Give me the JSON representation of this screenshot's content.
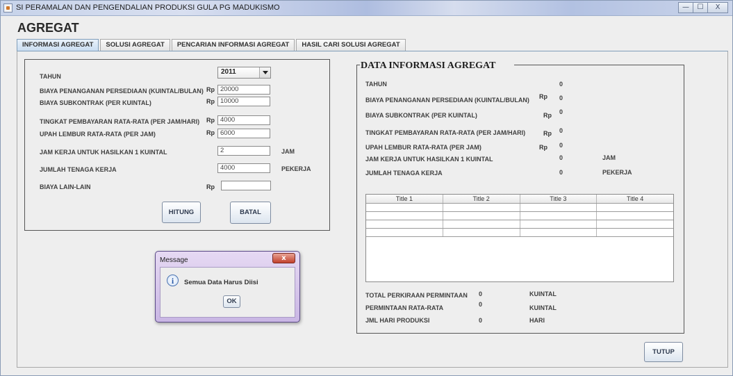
{
  "window": {
    "title": "SI PERAMALAN DAN PENGENDALIAN PRODUKSI GULA PG MADUKISMO"
  },
  "controls": {
    "minimize": "—",
    "maximize": "☐",
    "close": "X"
  },
  "page": {
    "heading": "AGREGAT"
  },
  "tabs": [
    {
      "label": "INFORMASI AGREGAT",
      "active": true
    },
    {
      "label": "SOLUSI AGREGAT"
    },
    {
      "label": "PENCARIAN INFORMASI AGREGAT"
    },
    {
      "label": "HASIL CARI SOLUSI AGREGAT"
    }
  ],
  "form": {
    "rp": "Rp",
    "tahun": {
      "label": "TAHUN",
      "value": "2011"
    },
    "biaya_penanganan": {
      "label": "BIAYA PENANGANAN PERSEDIAAN (KUINTAL/BULAN)",
      "value": "20000"
    },
    "biaya_subkontrak": {
      "label": "BIAYA SUBKONTRAK (PER KUINTAL)",
      "value": "10000"
    },
    "tingkat_pembayaran": {
      "label": "TINGKAT PEMBAYARAN RATA-RATA (PER JAM/HARI)",
      "value": "4000"
    },
    "upah_lembur": {
      "label": "UPAH LEMBUR RATA-RATA (PER JAM)",
      "value": "6000"
    },
    "jam_kerja": {
      "label": "JAM KERJA UNTUK HASILKAN 1 KUINTAL",
      "value": "2",
      "unit": "JAM"
    },
    "jumlah_tenaga": {
      "label": "JUMLAH TENAGA KERJA",
      "value": "4000",
      "unit": "PEKERJA"
    },
    "biaya_lain": {
      "label": "BIAYA LAIN-LAIN",
      "value": ""
    },
    "hitung_label": "HITUNG",
    "batal_label": "BATAL"
  },
  "info": {
    "title": "DATA INFORMASI AGREGAT",
    "rp": "Rp",
    "tahun": {
      "label": "TAHUN",
      "value": "0"
    },
    "biaya_penanganan": {
      "label": "BIAYA PENANGANAN PERSEDIAAN (KUINTAL/BULAN)",
      "value": "0"
    },
    "biaya_subkontrak": {
      "label": "BIAYA SUBKONTRAK (PER KUINTAL)",
      "value": "0"
    },
    "tingkat_pembayaran": {
      "label": "TINGKAT PEMBAYARAN RATA-RATA (PER JAM/HARI)",
      "value": "0"
    },
    "upah_lembur": {
      "label": "UPAH LEMBUR RATA-RATA (PER JAM)",
      "value": "0"
    },
    "jam_kerja": {
      "label": "JAM KERJA UNTUK HASILKAN 1 KUINTAL",
      "value": "0",
      "unit": "JAM"
    },
    "jumlah_tenaga": {
      "label": "JUMLAH TENAGA KERJA",
      "value": "0",
      "unit": "PEKERJA"
    },
    "table": {
      "headers": [
        "Title 1",
        "Title 2",
        "Title 3",
        "Title 4"
      ]
    },
    "total_permintaan": {
      "label": "TOTAL PERKIRAAN PERMINTAAN",
      "value": "0",
      "unit": "KUINTAL"
    },
    "permintaan_rata": {
      "label": "PERMINTAAN RATA-RATA",
      "value": "0",
      "unit": "KUINTAL"
    },
    "hari_produksi": {
      "label": "JML HARI  PRODUKSI",
      "value": "0",
      "unit": "HARI"
    }
  },
  "tutup_label": "TUTUP",
  "dialog": {
    "title": "Message",
    "message": "Semua Data Harus Diisi",
    "ok_label": "OK",
    "close": "x"
  }
}
